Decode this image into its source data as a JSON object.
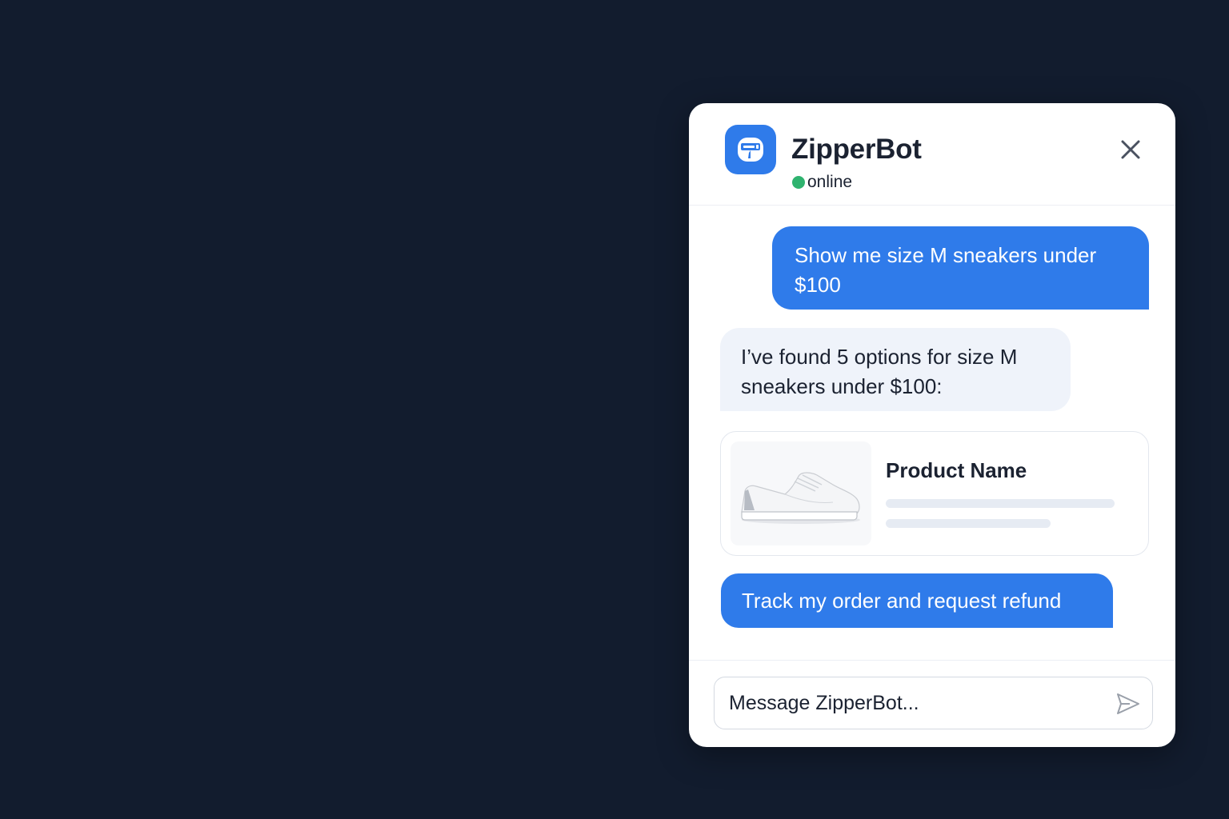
{
  "header": {
    "bot_name": "ZipperBot",
    "status": "online",
    "status_color": "#2fb36f",
    "avatar_icon": "zipper-bot-icon",
    "close_icon": "close-icon"
  },
  "messages": {
    "user_query": "Show me size M sneakers under $100",
    "bot_reply": "I’ve found 5 options for size M sneakers under $100:",
    "product": {
      "name": "Product Name",
      "image_icon": "sneaker-image"
    },
    "quick_action": "Track my order and request refund"
  },
  "composer": {
    "placeholder": "Message ZipperBot...",
    "value": "",
    "send_icon": "send-icon"
  },
  "colors": {
    "accent": "#2f7bea",
    "background": "#121c2e",
    "bot_bubble": "#eff3fa"
  }
}
